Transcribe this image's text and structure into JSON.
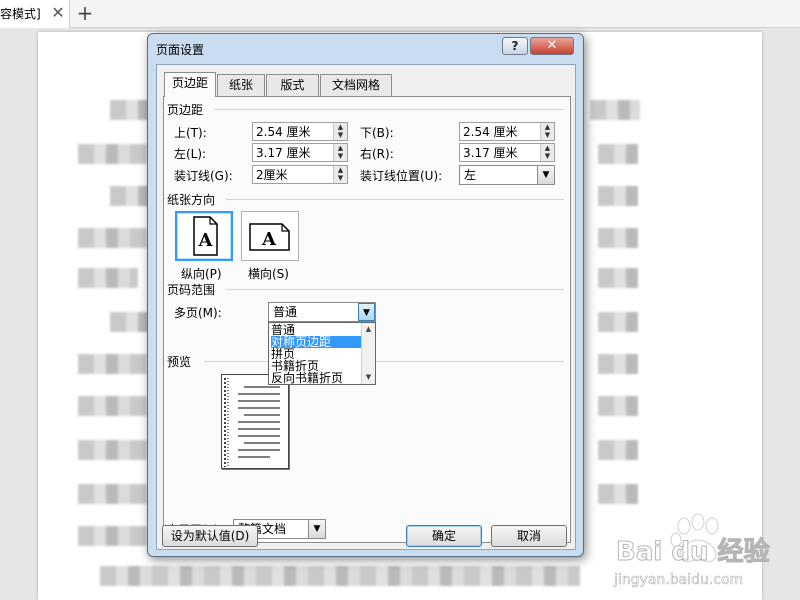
{
  "app_tab": {
    "title": "容模式]",
    "close_symbol": "✕",
    "add_symbol": "+"
  },
  "dialog": {
    "title": "页面设置",
    "help_symbol": "?",
    "close_symbol": "✕",
    "tabs": [
      {
        "label": "页边距",
        "active": true
      },
      {
        "label": "纸张",
        "active": false
      },
      {
        "label": "版式",
        "active": false
      },
      {
        "label": "文档网格",
        "active": false
      }
    ],
    "margins": {
      "section_title": "页边距",
      "top_label": "上(T):",
      "top_value": "2.54 厘米",
      "bottom_label": "下(B):",
      "bottom_value": "2.54 厘米",
      "left_label": "左(L):",
      "left_value": "3.17 厘米",
      "right_label": "右(R):",
      "right_value": "3.17 厘米",
      "gutter_label": "装订线(G):",
      "gutter_value": "2厘米",
      "gutter_pos_label": "装订线位置(U):",
      "gutter_pos_value": "左"
    },
    "orientation": {
      "section_title": "纸张方向",
      "portrait_label": "纵向(P)",
      "landscape_label": "横向(S)",
      "glyph": "A",
      "selected": "portrait"
    },
    "pages": {
      "section_title": "页码范围",
      "multi_label": "多页(M):",
      "multi_value": "普通",
      "options": [
        "普通",
        "对称页边距",
        "拼页",
        "书籍折页",
        "反向书籍折页"
      ],
      "highlighted_option": "对称页边距"
    },
    "preview": {
      "section_title": "预览"
    },
    "apply": {
      "label": "应用于(Y):",
      "value": "整篇文档"
    },
    "buttons": {
      "default_label": "设为默认值(D)",
      "ok_label": "确定",
      "cancel_label": "取消"
    }
  },
  "colors": {
    "dialog_frame": "#c9dcf0",
    "selection": "#3399ff",
    "close_red": "#c7412f"
  },
  "watermark": {
    "brand": "Bai du 经验",
    "url": "jingyan.baidu.com"
  }
}
